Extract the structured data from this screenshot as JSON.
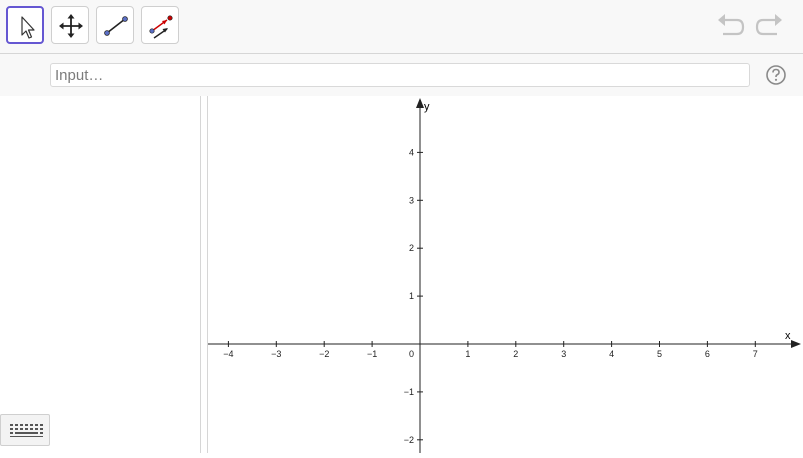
{
  "toolbar": {
    "tools": [
      {
        "name": "move-tool-icon",
        "selected": true
      },
      {
        "name": "move-graphics-view-icon",
        "selected": false
      },
      {
        "name": "segment-tool-icon",
        "selected": false
      },
      {
        "name": "vector-tool-icon",
        "selected": false
      }
    ],
    "undo_icon": "undo-icon",
    "redo_icon": "redo-icon"
  },
  "inputbar": {
    "placeholder": "Input…",
    "help_icon": "help-icon"
  },
  "graphics": {
    "x_axis_label": "x",
    "y_axis_label": "y",
    "origin_label": "0",
    "x_ticks": [
      "−4",
      "−3",
      "−2",
      "−1",
      "1",
      "2",
      "3",
      "4",
      "5",
      "6",
      "7"
    ],
    "x_tick_values": [
      -4,
      -3,
      -2,
      -1,
      1,
      2,
      3,
      4,
      5,
      6,
      7
    ],
    "y_ticks": [
      "4",
      "3",
      "2",
      "1",
      "−1",
      "−2"
    ],
    "y_tick_values": [
      4,
      3,
      2,
      1,
      -1,
      -2
    ]
  },
  "colors": {
    "accent": "#6557d2",
    "point": "#2f3a8f",
    "vector_red": "#cc0000"
  },
  "keyboard": {
    "icon": "keyboard-icon"
  }
}
